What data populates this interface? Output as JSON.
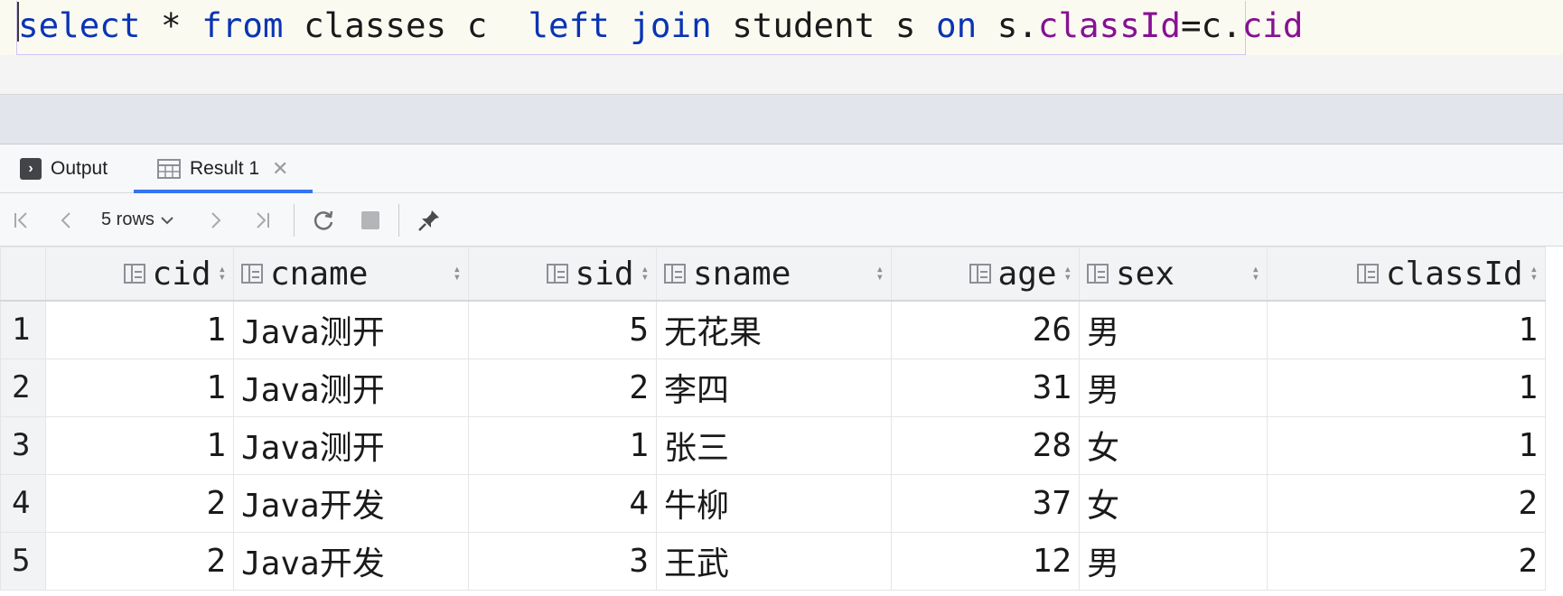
{
  "editor": {
    "tokens": [
      {
        "text": "select",
        "kind": "kw"
      },
      {
        "text": " ",
        "kind": "pl"
      },
      {
        "text": "*",
        "kind": "op"
      },
      {
        "text": " ",
        "kind": "pl"
      },
      {
        "text": "from",
        "kind": "kw"
      },
      {
        "text": " classes c  ",
        "kind": "pl"
      },
      {
        "text": "left",
        "kind": "kw"
      },
      {
        "text": " ",
        "kind": "pl"
      },
      {
        "text": "join",
        "kind": "kw"
      },
      {
        "text": " student s ",
        "kind": "pl"
      },
      {
        "text": "on",
        "kind": "kw"
      },
      {
        "text": " s.",
        "kind": "pl"
      },
      {
        "text": "classId",
        "kind": "fld"
      },
      {
        "text": "=c.",
        "kind": "pl"
      },
      {
        "text": "cid",
        "kind": "fld"
      }
    ]
  },
  "tabs": {
    "output_label": "Output",
    "output_icon": "terminal-icon",
    "result_label": "Result 1",
    "result_icon": "table-icon",
    "active_tab_color": "#3574f0"
  },
  "toolbar": {
    "rows_label": "5 rows",
    "icons": [
      "first-page-icon",
      "previous-page-icon",
      "next-page-icon",
      "last-page-icon",
      "refresh-icon",
      "stop-icon",
      "pin-icon"
    ]
  },
  "grid": {
    "columns": [
      {
        "name": "cid",
        "align": "right"
      },
      {
        "name": "cname",
        "align": "left"
      },
      {
        "name": "sid",
        "align": "right"
      },
      {
        "name": "sname",
        "align": "left"
      },
      {
        "name": "age",
        "align": "right"
      },
      {
        "name": "sex",
        "align": "left"
      },
      {
        "name": "classId",
        "align": "right"
      }
    ],
    "rows": [
      {
        "n": "1",
        "cells": [
          "1",
          "Java测开",
          "5",
          "无花果",
          "26",
          "男",
          "1"
        ]
      },
      {
        "n": "2",
        "cells": [
          "1",
          "Java测开",
          "2",
          "李四",
          "31",
          "男",
          "1"
        ]
      },
      {
        "n": "3",
        "cells": [
          "1",
          "Java测开",
          "1",
          "张三",
          "28",
          "女",
          "1"
        ]
      },
      {
        "n": "4",
        "cells": [
          "2",
          "Java开发",
          "4",
          "牛柳",
          "37",
          "女",
          "2"
        ]
      },
      {
        "n": "5",
        "cells": [
          "2",
          "Java开发",
          "3",
          "王武",
          "12",
          "男",
          "2"
        ]
      }
    ]
  }
}
